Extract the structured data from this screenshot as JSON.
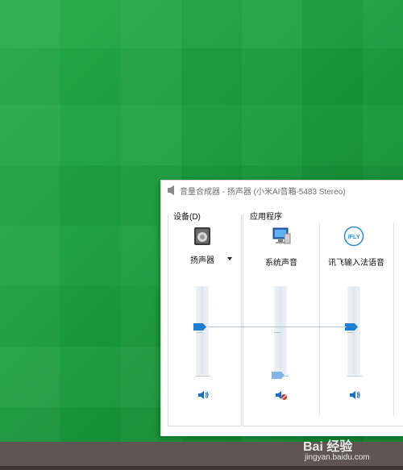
{
  "window": {
    "title": "音量合成器 - 扬声器 (小米AI音箱-5483 Stereo)"
  },
  "device_group": {
    "label": "设备(D)",
    "device": {
      "name": "扬声器",
      "icon": "speaker-icon",
      "volume_fraction": 0.46,
      "muted": false
    }
  },
  "apps_group": {
    "label": "应用程序",
    "apps": [
      {
        "name": "系统声音",
        "icon": "system-sounds-icon",
        "volume_fraction": 0.0,
        "muted": true
      },
      {
        "name": "讯飞输入法语音",
        "icon": "ifly-icon",
        "icon_text": "iFLY",
        "volume_fraction": 0.46,
        "muted": false
      }
    ]
  },
  "watermark": {
    "text": "Bai 经验",
    "url": "jingyan.baidu.com"
  },
  "colors": {
    "accent": "#1e7fd1",
    "desktop": "#1a9a3f",
    "taskbar": "#5f5553"
  }
}
